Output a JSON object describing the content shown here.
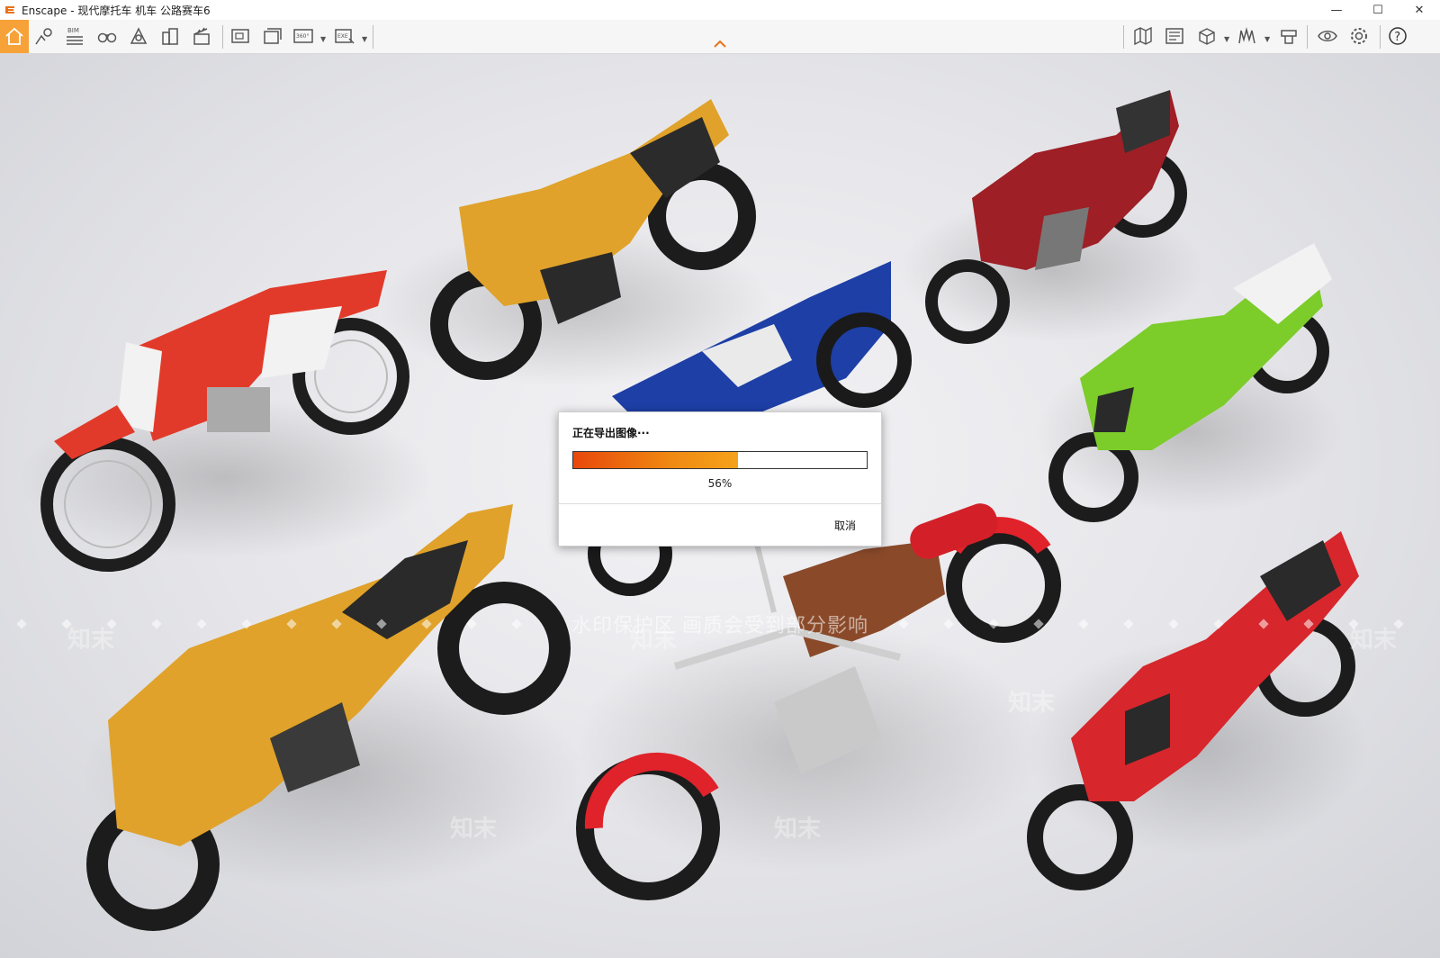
{
  "window": {
    "title": "Enscape - 现代摩托车 机车 公路赛车6",
    "controls": {
      "minimize": "—",
      "maximize": "☐",
      "close": "✕"
    }
  },
  "toolbar": {
    "left": [
      {
        "name": "home-icon",
        "active": true
      },
      {
        "name": "map-pin-icon"
      },
      {
        "name": "bim-icon",
        "label": "BIM"
      },
      {
        "name": "binoculars-icon"
      },
      {
        "name": "atmosphere-icon"
      },
      {
        "name": "buildings-icon"
      },
      {
        "name": "clapperboard-icon"
      },
      {
        "name": "screenshot-icon"
      },
      {
        "name": "batch-render-icon"
      },
      {
        "name": "panorama-360-icon",
        "label": "360°"
      },
      {
        "name": "export-exe-icon",
        "label": "EXE"
      }
    ],
    "right": [
      {
        "name": "map-icon"
      },
      {
        "name": "asset-library-icon"
      },
      {
        "name": "cube-icon"
      },
      {
        "name": "materials-icon"
      },
      {
        "name": "collaboration-icon"
      },
      {
        "name": "eye-icon"
      },
      {
        "name": "gear-icon"
      },
      {
        "name": "help-icon",
        "label": "?"
      }
    ],
    "accent_color": "#f7a238"
  },
  "viewport": {
    "watermark_text": "水印保护区   画质会受到部分影响",
    "watermark_logo": "知末"
  },
  "export_dialog": {
    "title": "正在导出图像···",
    "progress_percent": 56,
    "progress_label": "56%",
    "cancel_label": "取消"
  }
}
